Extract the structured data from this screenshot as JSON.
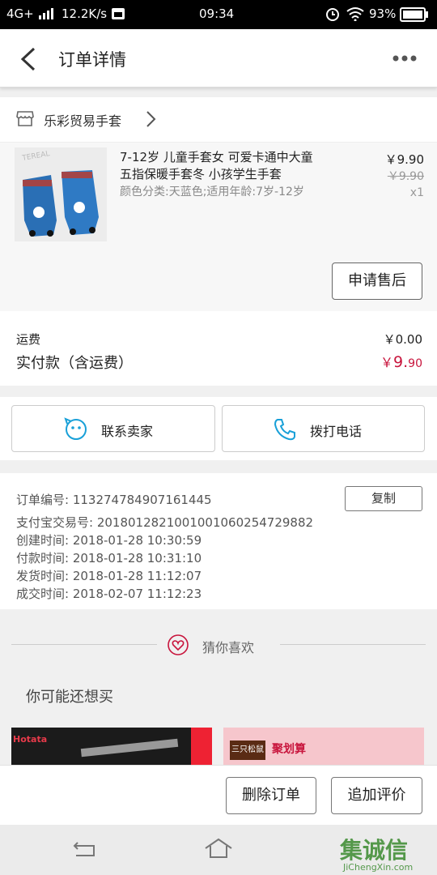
{
  "status_bar": {
    "network": "4G+",
    "speed": "12.2K/s",
    "time": "09:34",
    "battery": "93%"
  },
  "header": {
    "title": "订单详情"
  },
  "shop": {
    "name": "乐彩贸易手套"
  },
  "product": {
    "title_line1": "7-12岁 儿童手套女 可爱卡通中大童",
    "title_line2": "五指保暖手套冬 小孩学生手套",
    "sku": "颜色分类:天蓝色;适用年龄:7岁-12岁",
    "price": "￥9.90",
    "original_price": "￥9.90",
    "quantity": "x1",
    "after_sale_button": "申请售后"
  },
  "fees": {
    "shipping_label": "运费",
    "shipping_value": "￥0.00",
    "paid_label": "实付款（含运费）",
    "paid_currency": "￥",
    "paid_int": "9.",
    "paid_dec": "90"
  },
  "contact": {
    "seller_button": "联系卖家",
    "call_button": "拨打电话"
  },
  "order_info": {
    "order_no": "订单编号: 113274784907161445",
    "copy_button": "复制",
    "alipay_no": "支付宝交易号: 2018012821001001060254729882",
    "created": "创建时间: 2018-01-28 10:30:59",
    "paid": "付款时间: 2018-01-28 10:31:10",
    "shipped": "发货时间: 2018-01-28 11:12:07",
    "completed": "成交时间: 2018-02-07 11:12:23"
  },
  "recommend": {
    "divider_label": "猜你喜欢",
    "subtitle": "你可能还想买"
  },
  "recommend_cards": {
    "card1_brand": "Hotata",
    "card2_brand": "三只松鼠",
    "card2_tag": "聚划算"
  },
  "actions": {
    "delete_button": "删除订单",
    "review_button": "追加评价"
  },
  "watermark": {
    "text": "集诚信",
    "url": "JiChengXin.com"
  },
  "colors": {
    "accent_red": "#c8143c",
    "bottom_bar": "#ffffff"
  }
}
